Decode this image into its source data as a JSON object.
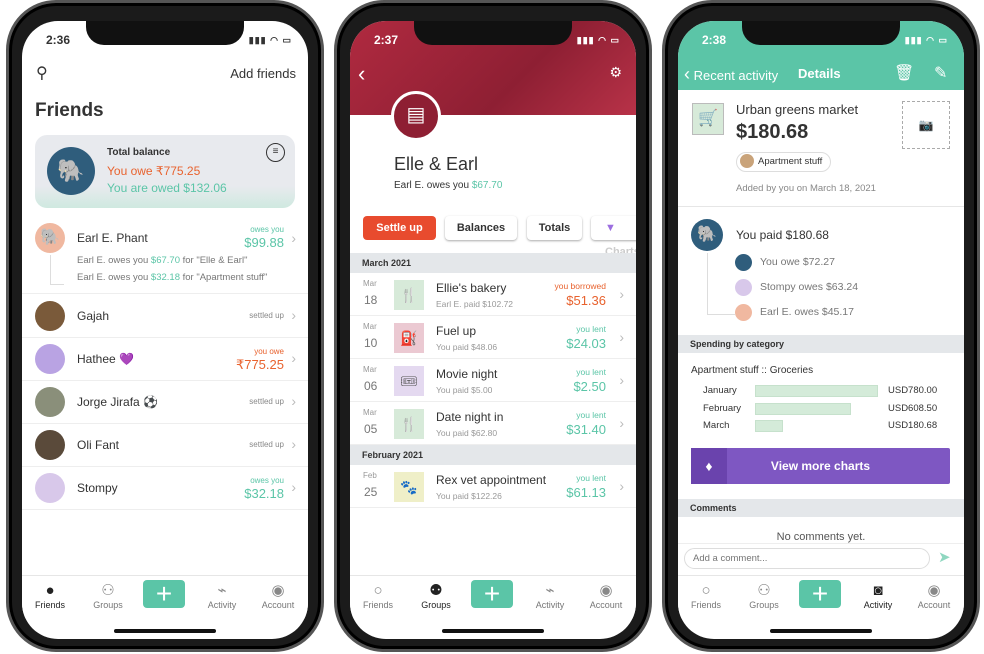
{
  "colors": {
    "accent": "#5bc5a7",
    "owe": "#e8622e",
    "header_red": "#a3263a",
    "settle": "#e84b2e",
    "premium": "#7e57c2"
  },
  "tabs": [
    "Friends",
    "Groups",
    "Activity",
    "Account"
  ],
  "friends": {
    "time": "2:36",
    "add_friends": "Add friends",
    "title": "Friends",
    "balance": {
      "label": "Total balance",
      "owe": "You owe ₹775.25",
      "owed": "You are owed $132.06"
    },
    "earl": {
      "name": "Earl E. Phant",
      "status": "owes you",
      "amount": "$99.88",
      "details": [
        {
          "pre": "Earl E. owes you ",
          "amt": "$67.70",
          "post": " for \"Elle & Earl\""
        },
        {
          "pre": "Earl E. owes you ",
          "amt": "$32.18",
          "post": " for \"Apartment stuff\""
        }
      ]
    },
    "list": [
      {
        "name": "Gajah",
        "status": "settled up",
        "amount": "",
        "tone": "none",
        "avbg": "#7a5a3a"
      },
      {
        "name": "Hathee 💜",
        "status": "you owe",
        "amount": "₹775.25",
        "tone": "orange",
        "avbg": "#b9a3e3"
      },
      {
        "name": "Jorge Jirafa ⚽",
        "status": "settled up",
        "amount": "",
        "tone": "none",
        "avbg": "#8a8f7a"
      },
      {
        "name": "Oli Fant",
        "status": "settled up",
        "amount": "",
        "tone": "none",
        "avbg": "#5a4a3a"
      },
      {
        "name": "Stompy",
        "status": "owes you",
        "amount": "$32.18",
        "tone": "green",
        "avbg": "#d8c8ea"
      }
    ]
  },
  "group": {
    "time": "2:37",
    "name": "Elle & Earl",
    "summary_pre": "Earl E. owes you ",
    "summary_amt": "$67.70",
    "buttons": [
      "Settle up",
      "Balances",
      "Totals",
      "Charts"
    ],
    "sections": [
      {
        "title": "March 2021",
        "items": [
          {
            "mon": "Mar",
            "day": "18",
            "title": "Ellie's bakery",
            "sub": "Earl E. paid $102.72",
            "status": "you borrowed",
            "amount": "$51.36",
            "tone": "orange",
            "icon": "🍴",
            "iconbg": "#d7ead9",
            "iconname": "fork-knife-icon"
          },
          {
            "mon": "Mar",
            "day": "10",
            "title": "Fuel up",
            "sub": "You paid $48.06",
            "status": "you lent",
            "amount": "$24.03",
            "tone": "green",
            "icon": "⛽",
            "iconbg": "#ebc9d2",
            "iconname": "fuel-pump-icon"
          },
          {
            "mon": "Mar",
            "day": "06",
            "title": "Movie night",
            "sub": "You paid $5.00",
            "status": "you lent",
            "amount": "$2.50",
            "tone": "green",
            "icon": "🎟",
            "iconbg": "#e4d9f0",
            "iconname": "tickets-icon"
          },
          {
            "mon": "Mar",
            "day": "05",
            "title": "Date night in",
            "sub": "You paid $62.80",
            "status": "you lent",
            "amount": "$31.40",
            "tone": "green",
            "icon": "🍴",
            "iconbg": "#d7ead9",
            "iconname": "fork-knife-icon"
          }
        ]
      },
      {
        "title": "February 2021",
        "items": [
          {
            "mon": "Feb",
            "day": "25",
            "title": "Rex vet appointment",
            "sub": "You paid $122.26",
            "status": "you lent",
            "amount": "$61.13",
            "tone": "green",
            "icon": "🐾",
            "iconbg": "#efefc8",
            "iconname": "paw-icon"
          }
        ]
      }
    ]
  },
  "details": {
    "time": "2:38",
    "back": "Recent activity",
    "title": "Details",
    "name": "Urban greens market",
    "amount": "$180.68",
    "group": "Apartment stuff",
    "added": "Added by you on March 18, 2021",
    "paid": "You paid $180.68",
    "shares": [
      {
        "text": "You owe $72.27",
        "avbg": "#2f5d7c"
      },
      {
        "text": "Stompy owes $63.24",
        "avbg": "#d8c8ea"
      },
      {
        "text": "Earl E. owes $45.17",
        "avbg": "#f0b8a0"
      }
    ],
    "spending_header": "Spending by category",
    "category": "Apartment stuff :: Groceries",
    "spending": [
      {
        "month": "January",
        "value": 780.0,
        "label": "USD780.00"
      },
      {
        "month": "February",
        "value": 608.5,
        "label": "USD608.50"
      },
      {
        "month": "March",
        "value": 180.68,
        "label": "USD180.68"
      }
    ],
    "more_charts": "View more charts",
    "comments_header": "Comments",
    "no_comments": "No comments yet.",
    "comment_placeholder": "Add a comment..."
  }
}
